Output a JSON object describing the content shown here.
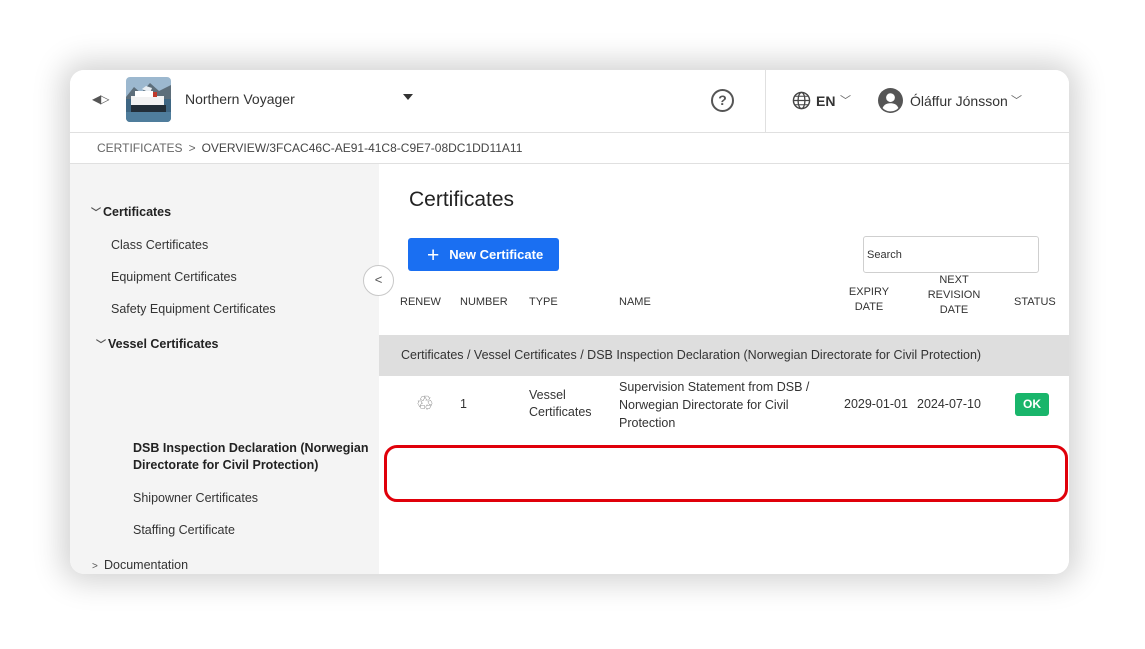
{
  "header": {
    "vessel_name": "Northern Voyager",
    "help_glyph": "?",
    "language": "EN",
    "user_name": "Óláffur Jónsson"
  },
  "breadcrumb": {
    "root": "CERTIFICATES",
    "separator": ">",
    "current": "OVERVIEW/3FCAC46C-AE91-41C8-C9E7-08DC1DD11A11"
  },
  "sidebar": {
    "certificates_group": "Certificates",
    "items": [
      "Class Certificates",
      "Equipment Certificates",
      "Safety Equipment Certificates"
    ],
    "vessel_group": "Vessel Certificates",
    "vessel_items": [
      "DSB Inspection Declaration (Norwegian Directorate for Civil Protection)",
      "Shipowner Certificates",
      "Staffing Certificate"
    ],
    "documentation": "Documentation"
  },
  "main": {
    "title": "Certificates",
    "new_button": "New Certificate",
    "search_placeholder": "Search",
    "columns": {
      "renew": "RENEW",
      "number": "NUMBER",
      "type": "TYPE",
      "name": "NAME",
      "expiry": "EXPIRY DATE",
      "next_revision": "NEXT REVISION DATE",
      "status": "STATUS"
    },
    "group_row": "Certificates / Vessel Certificates / DSB Inspection Declaration (Norwegian Directorate for Civil Protection)",
    "row": {
      "number": "1",
      "type": "Vessel Certificates",
      "name": "Supervision Statement from DSB / Norwegian Directorate for Civil Protection",
      "expiry": "2029-01-01",
      "next_revision": "2024-07-10",
      "status": "OK"
    }
  },
  "colors": {
    "accent": "#1a6ff2",
    "status_ok": "#19b56b",
    "highlight": "#e0000a"
  },
  "icons": [
    "collapse-arrows-icon",
    "vessel-thumbnail",
    "chevron-down-icon",
    "help-icon",
    "globe-icon",
    "user-avatar-icon",
    "chevron-left-icon",
    "plus-icon",
    "recycle-icon"
  ]
}
